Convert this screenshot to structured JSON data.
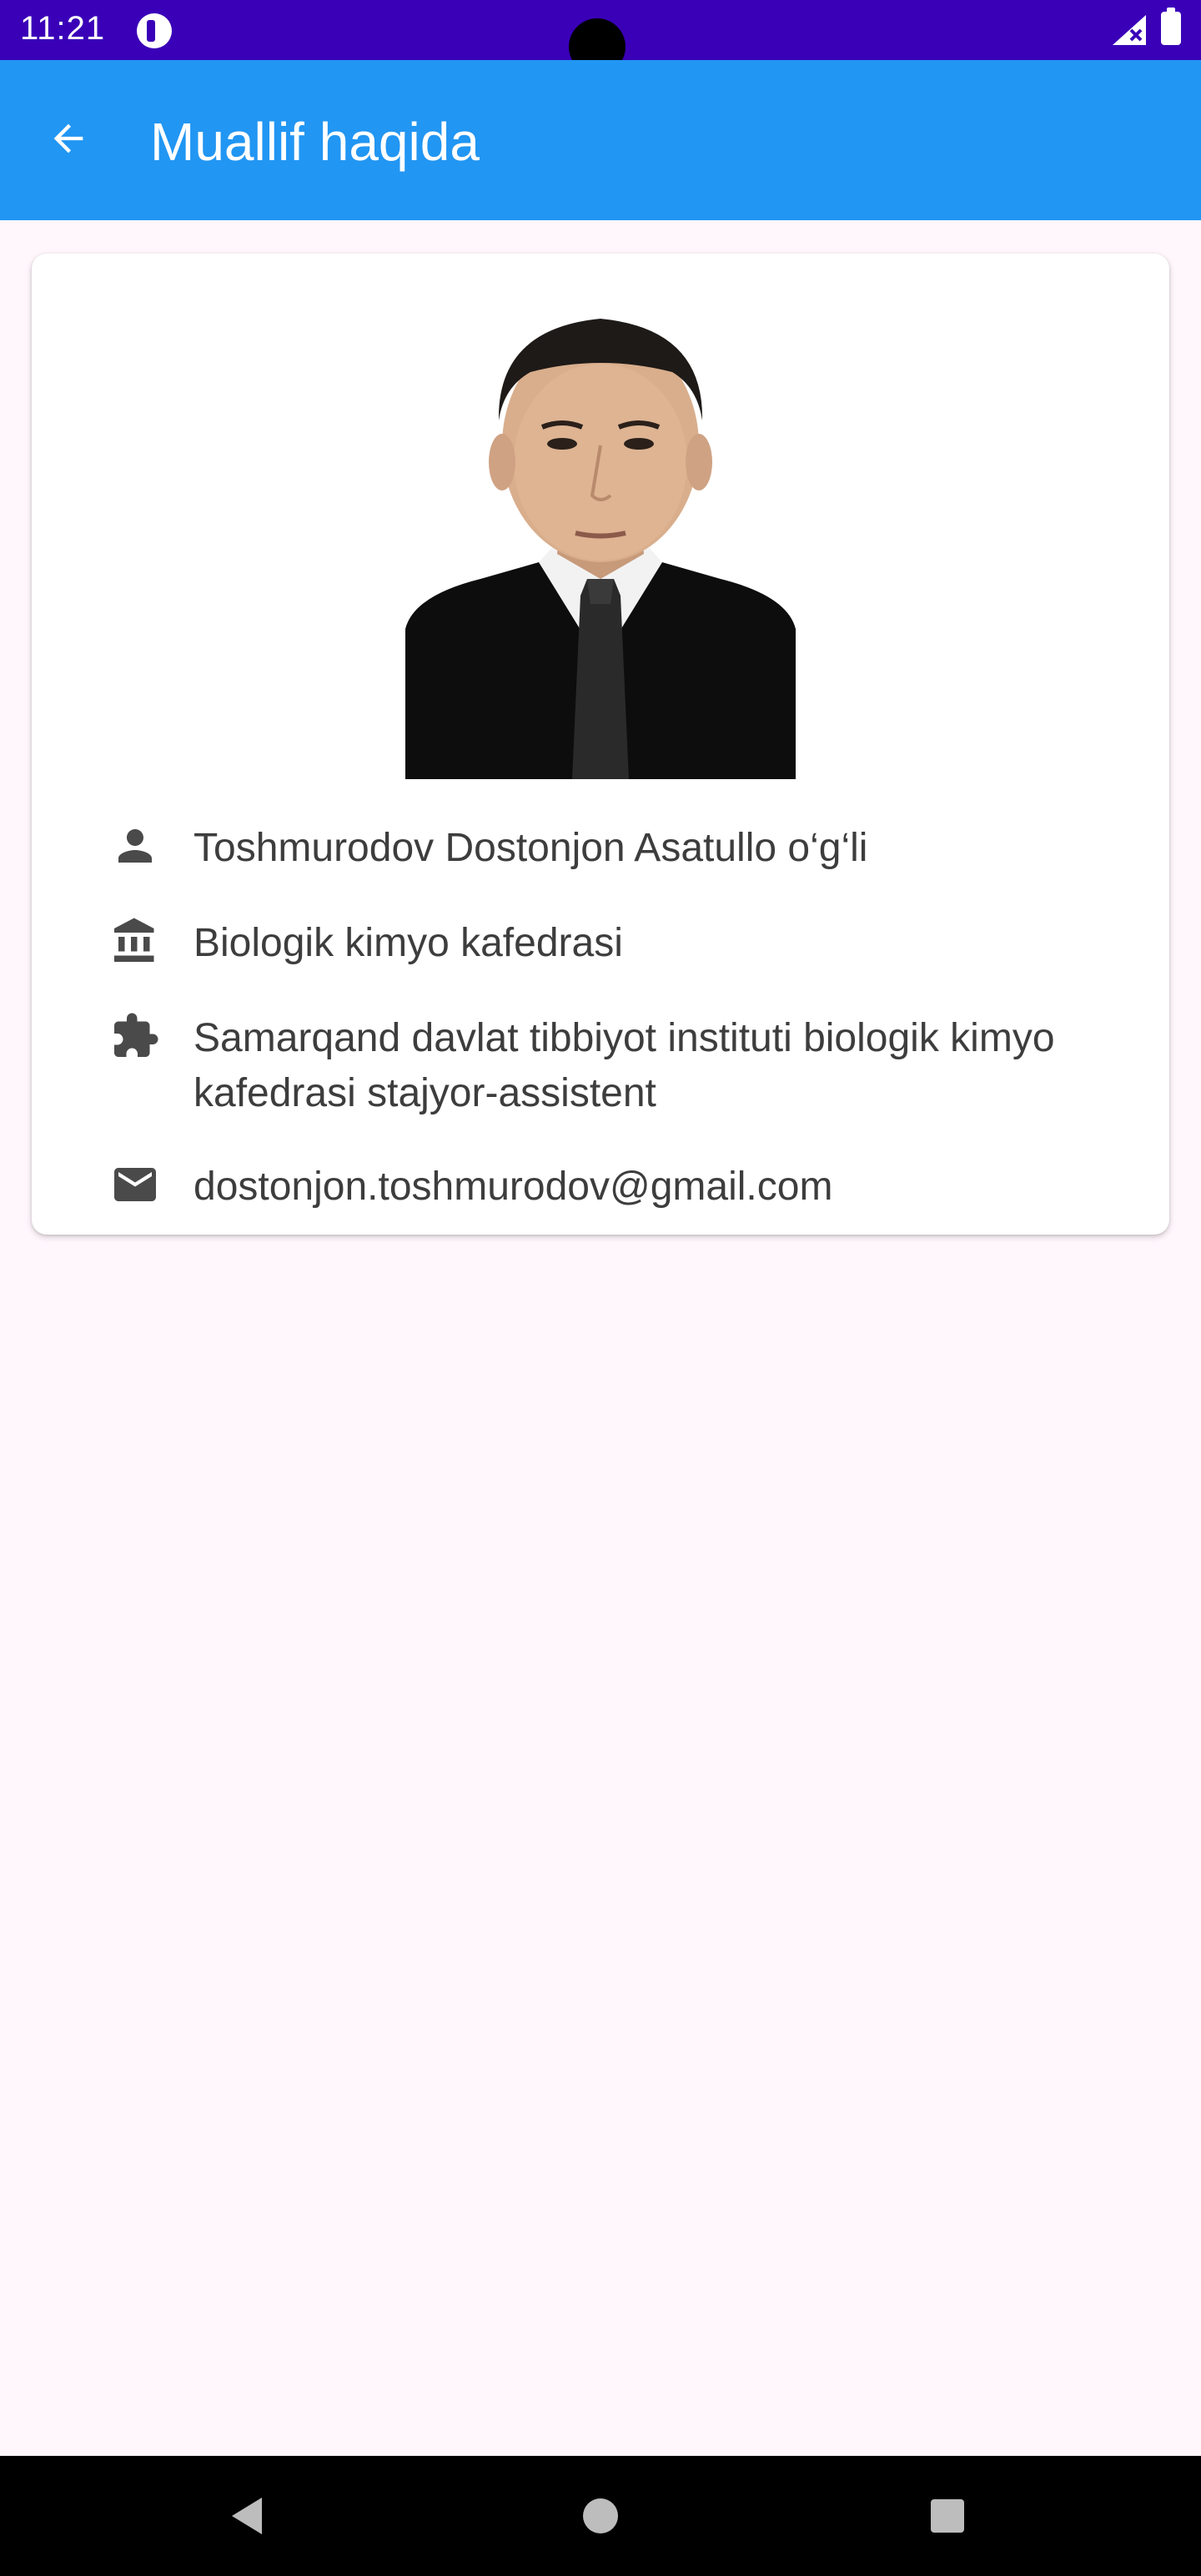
{
  "status_bar": {
    "time": "11:21",
    "icons": [
      "app-notification-icon",
      "signal-no-data-icon",
      "battery-icon"
    ]
  },
  "app_bar": {
    "title": "Muallif haqida",
    "back_icon": "arrow-back-icon",
    "color": "#2196f3"
  },
  "profile": {
    "photo": "portrait-photo",
    "name": "Toshmurodov Dostonjon Asatullo o‘g‘li",
    "department": "Biologik kimyo kafedrasi",
    "position": "Samarqand davlat tibbiyot instituti biologik kimyo kafedrasi stajyor-assistent",
    "email": "dostonjon.toshmurodov@gmail.com",
    "icons": [
      "person-icon",
      "institution-icon",
      "puzzle-icon",
      "mail-icon"
    ]
  },
  "nav_bar": {
    "buttons": [
      "back-triangle-icon",
      "home-circle-icon",
      "recents-square-icon"
    ]
  },
  "colors": {
    "status_bar": "#3a00b8",
    "background": "#fff7fc",
    "text": "#3d3d3d"
  }
}
